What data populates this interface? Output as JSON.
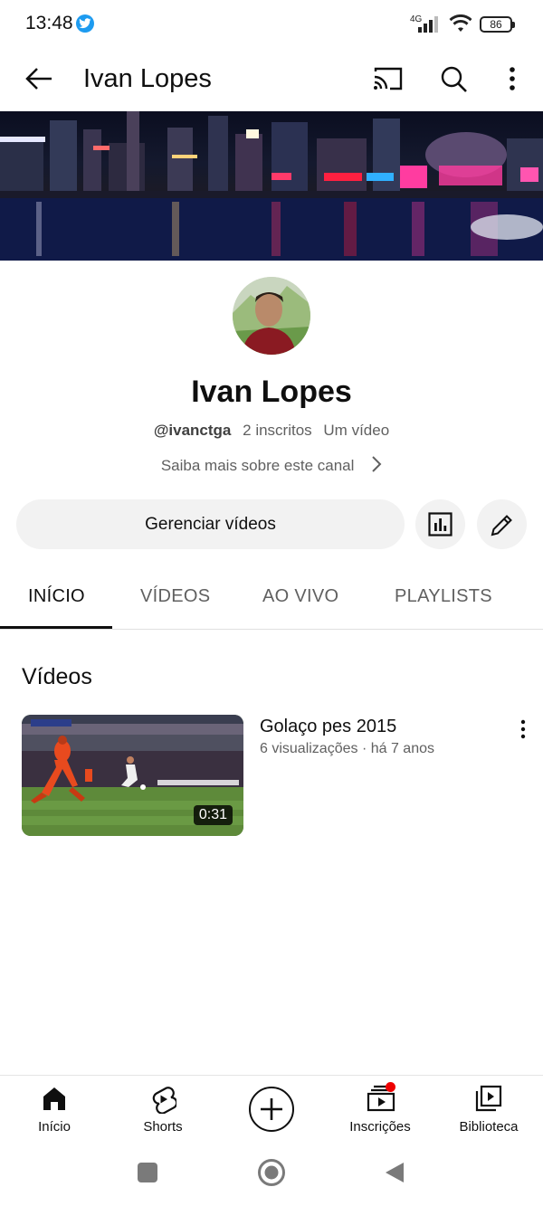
{
  "status_bar": {
    "time": "13:48",
    "network": "4G",
    "battery": "86",
    "icons": [
      "twitter-icon",
      "signal-icon",
      "wifi-icon",
      "battery-icon"
    ]
  },
  "app_bar": {
    "title": "Ivan Lopes",
    "icons": [
      "back-arrow-icon",
      "cast-icon",
      "search-icon",
      "more-vert-icon"
    ]
  },
  "channel": {
    "name": "Ivan Lopes",
    "handle": "@ivanctga",
    "subscribers": "2 inscritos",
    "video_count": "Um vídeo",
    "about_link": "Saiba mais sobre este canal"
  },
  "actions": {
    "manage_videos": "Gerenciar vídeos",
    "icons": [
      "analytics-icon",
      "edit-pencil-icon"
    ]
  },
  "tabs": [
    {
      "label": "INÍCIO",
      "active": true
    },
    {
      "label": "VÍDEOS",
      "active": false
    },
    {
      "label": "AO VIVO",
      "active": false
    },
    {
      "label": "PLAYLISTS",
      "active": false
    }
  ],
  "section": {
    "title": "Vídeos"
  },
  "videos": [
    {
      "title": "Golaço pes 2015",
      "meta": "6 visualizações · há 7 anos",
      "duration": "0:31"
    }
  ],
  "bottom_nav": [
    {
      "label": "Início",
      "icon": "home-icon"
    },
    {
      "label": "Shorts",
      "icon": "shorts-icon"
    },
    {
      "label": "",
      "icon": "create-plus-icon"
    },
    {
      "label": "Inscrições",
      "icon": "subscriptions-icon"
    },
    {
      "label": "Biblioteca",
      "icon": "library-icon"
    }
  ],
  "colors": {
    "accent": "#0f0f0f",
    "secondary_text": "#606060",
    "button_bg": "#f2f2f2",
    "notification": "#ee0000",
    "twitter": "#1d9bf0"
  }
}
